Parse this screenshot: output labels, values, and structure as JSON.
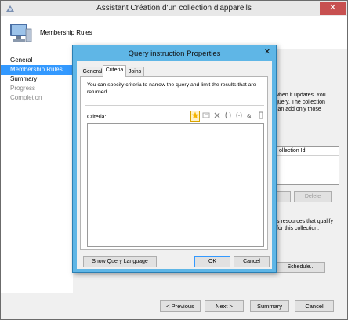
{
  "wizard": {
    "title": "Assistant Création d'un collection d'appareils",
    "header_title": "Membership Rules",
    "close_glyph": "✕",
    "nav": [
      {
        "label": "General",
        "state": "normal"
      },
      {
        "label": "Membership Rules",
        "state": "active"
      },
      {
        "label": "Summary",
        "state": "normal"
      },
      {
        "label": "Progress",
        "state": "disabled"
      },
      {
        "label": "Completion",
        "state": "disabled"
      }
    ],
    "background_text": {
      "line1": "when it updates. You",
      "line2": "query. The collection",
      "line3": "can add only those",
      "list_header": "ollection Id",
      "delete_label": "Delete",
      "resources_line1": "s resources that qualify",
      "resources_line2": "for this collection.",
      "schedule_label": "Schedule..."
    },
    "footer": {
      "previous": "< Previous",
      "next": "Next >",
      "summary": "Summary",
      "cancel": "Cancel"
    }
  },
  "dialog": {
    "title": "Query instruction Properties",
    "close_glyph": "✕",
    "tabs": [
      {
        "label": "General",
        "active": false
      },
      {
        "label": "Criteria",
        "active": true
      },
      {
        "label": "Joins",
        "active": false
      }
    ],
    "description": "You can specify criteria to narrow the query and limit the results that are returned.",
    "criteria_label": "Criteria:",
    "toolbar_icons": [
      "new-criterion-icon",
      "properties-icon",
      "delete-icon",
      "group-icon",
      "ungroup-icon",
      "and-or-icon",
      "move-icon"
    ],
    "show_query_language": "Show Query Language",
    "ok": "OK",
    "cancel": "Cancel"
  },
  "colors": {
    "accent": "#3399ff",
    "dialog_frame": "#5fb6e6",
    "close_red": "#c75050"
  }
}
